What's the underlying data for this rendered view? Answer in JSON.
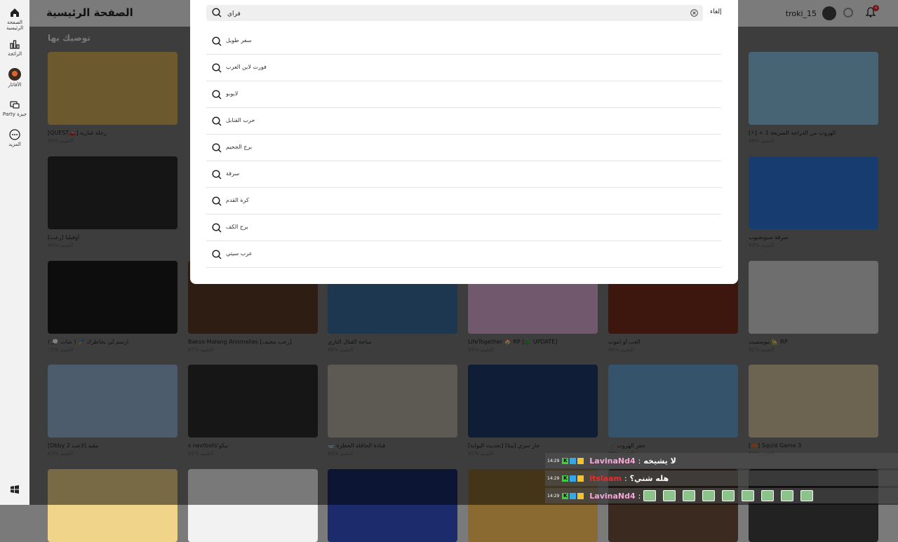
{
  "sidebar": {
    "items": [
      {
        "label": "الصفحة الرئيسية",
        "icon": "home-icon"
      },
      {
        "label": "الرائجة",
        "icon": "chart-icon"
      },
      {
        "label": "الأفاتار",
        "icon": "avatar-icon"
      },
      {
        "label": "Party جيزة",
        "icon": "party-icon"
      },
      {
        "label": "المزيد",
        "icon": "more-icon"
      }
    ]
  },
  "header": {
    "title": "الصفحة الرئيسية",
    "username": "troki_15",
    "notification_count": "4"
  },
  "section": {
    "title": "توصيك بها"
  },
  "search": {
    "value": "فراي",
    "cancel_label": "إلغاء",
    "suggestions": [
      "سفر طويل",
      "فورت لاين العرب",
      "لايوبو",
      "حرب القنابل",
      "برج الجحيم",
      "سرقة",
      "كرة القدم",
      "برج الكف",
      "عرب سيتي"
    ]
  },
  "games": [
    {
      "title": "[QUEST🚗] رحلة غبارية",
      "rating": "التقييم %90",
      "color": "#d9b25a"
    },
    {
      "title": "[⚡] + 1 الهروب من الدراجة السريعة",
      "rating": "التقييم %98",
      "color": "#8fc8e8"
    },
    {
      "title": "أوفيليا [رعب]",
      "rating": "التقييم %89",
      "color": "#2a2a2a"
    },
    {
      "title": "سرقة سبونجبوب",
      "rating": "التقييم %93",
      "color": "#2f7be0"
    },
    {
      "title": "ارسم لي بخاطرك 🖌️ ( شات 💭 )",
      "rating": "التقييم %75",
      "color": "#1a1a1a"
    },
    {
      "title": "Bakso Malang Anomalies [رعب مخيف]",
      "rating": "التقييم %87",
      "color": "#5a3a24"
    },
    {
      "title": "ساحة القتال التاري",
      "rating": "التقييم %88",
      "color": "#3b6fa0"
    },
    {
      "title": "LifeTogether 🏠 RP [🎄 UPDATE]",
      "rating": "التقييم %91",
      "color": "#e2b0d8"
    },
    {
      "title": "العب أو اموت",
      "rating": "التقييم %86",
      "color": "#7a2f1c"
    },
    {
      "title": "بيوسميت 🏡 RP",
      "rating": "التقييم %92",
      "color": "#dcdcdc"
    },
    {
      "title": "[Obby 2 لاعب] مقيد",
      "rating": "التقييم %83",
      "color": "#9bb8d8"
    },
    {
      "title": "s nextbots'نيكو",
      "rating": "التقييم %91",
      "color": "#2d2d2d"
    },
    {
      "title": "🚌 قيادة الحافلة الخطرة",
      "rating": "التقييم %90",
      "color": "#b9b4a5"
    },
    {
      "title": "[تحديث البوابة] جار سري [بيتا]",
      "rating": "التقييم %81",
      "color": "#1e3b6e"
    },
    {
      "title": "⛏️ حفر الهروب",
      "rating": "التقييم %85",
      "color": "#6aa9d6"
    },
    {
      "title": "[🦐] Squid Game 3",
      "rating": "التقييم %84",
      "color": "#d8c7a0"
    }
  ],
  "bottom_row": {
    "colors": [
      "#f0d48a",
      "#f2f2f2",
      "#1b2b6b",
      "#8a6a30",
      "#3a2a20",
      "#222222"
    ]
  },
  "chat": {
    "lines": [
      {
        "time": "14:29",
        "name": "LavinaNd4",
        "message": "لا يشيخه"
      },
      {
        "time": "14:29",
        "name": "itslaam",
        "message": "هله شني؟"
      },
      {
        "time": "14:29",
        "name": "LavinaNd4",
        "message": ""
      }
    ]
  },
  "colors": {
    "accent": "#e02d2d",
    "chat_name": "#f7a7d7"
  }
}
